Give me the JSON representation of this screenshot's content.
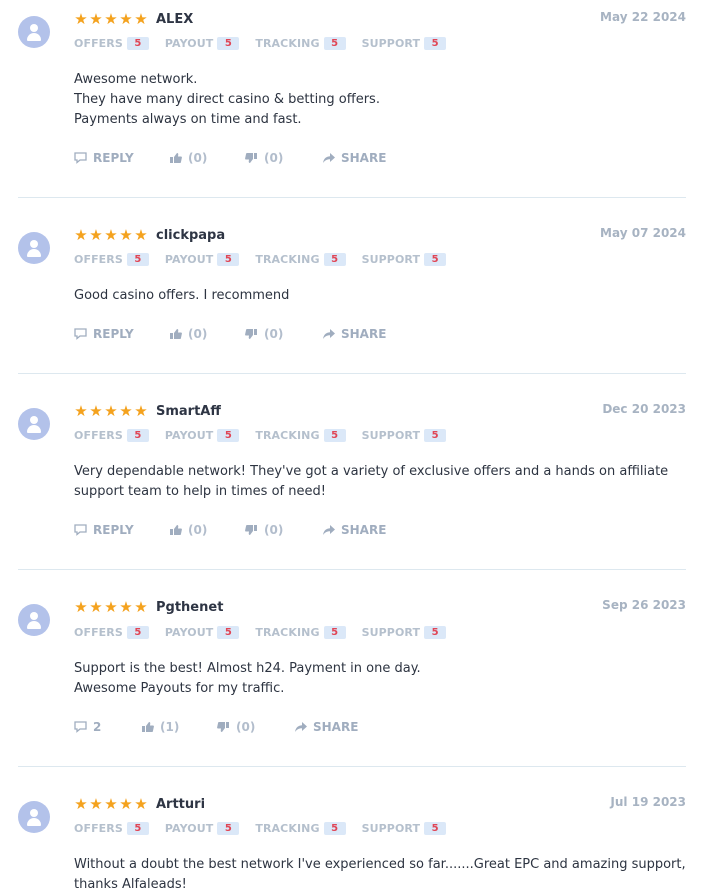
{
  "labels": {
    "categories": [
      "OFFERS",
      "PAYOUT",
      "TRACKING",
      "SUPPORT"
    ],
    "reply": "REPLY",
    "share": "SHARE"
  },
  "colors": {
    "star": "#f4a21e",
    "score_text": "#e04656",
    "score_bg": "#dbe8f8",
    "avatar": "#b3c2ea"
  },
  "reviews": [
    {
      "name": "ALEX",
      "date": "May 22 2024",
      "rating": 5,
      "scores": [
        "5",
        "5",
        "5",
        "5"
      ],
      "text": [
        "Awesome network.",
        "They have many direct casino & betting offers.",
        "Payments always on time and fast."
      ],
      "reply": "REPLY",
      "likes": "(0)",
      "dislikes": "(0)"
    },
    {
      "name": "clickpapa",
      "date": "May 07 2024",
      "rating": 5,
      "scores": [
        "5",
        "5",
        "5",
        "5"
      ],
      "text": [
        "Good casino offers. I recommend"
      ],
      "reply": "REPLY",
      "likes": "(0)",
      "dislikes": "(0)"
    },
    {
      "name": "SmartAff",
      "date": "Dec 20 2023",
      "rating": 5,
      "scores": [
        "5",
        "5",
        "5",
        "5"
      ],
      "text": [
        "Very dependable network! They've got a variety of exclusive offers and a hands on affiliate",
        "support team to help in times of need!"
      ],
      "reply": "REPLY",
      "likes": "(0)",
      "dislikes": "(0)"
    },
    {
      "name": "Pgthenet",
      "date": "Sep 26 2023",
      "rating": 5,
      "scores": [
        "5",
        "5",
        "5",
        "5"
      ],
      "text": [
        "Support is the best! Almost h24. Payment in one day.",
        "Awesome Payouts for my traffic."
      ],
      "reply": "2",
      "likes": "(1)",
      "dislikes": "(0)"
    },
    {
      "name": "Artturi",
      "date": "Jul 19 2023",
      "rating": 5,
      "scores": [
        "5",
        "5",
        "5",
        "5"
      ],
      "text": [
        "Without a doubt the best network I've experienced so far.......Great EPC and amazing support,",
        "thanks Alfaleads!"
      ]
    }
  ]
}
